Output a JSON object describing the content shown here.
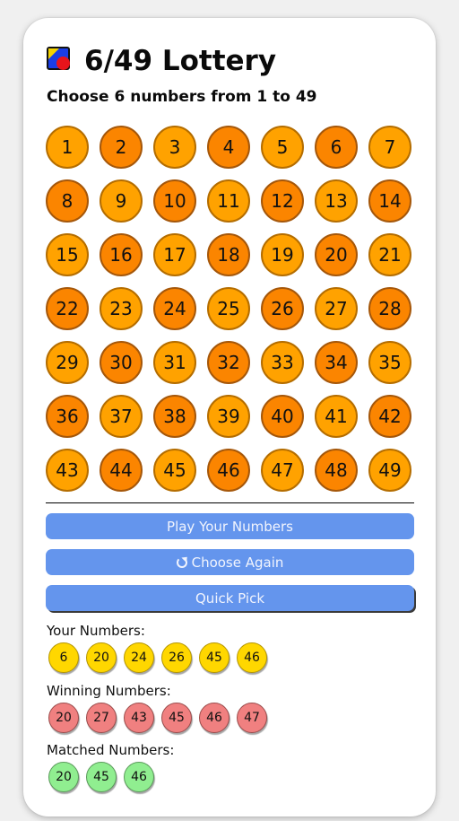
{
  "header": {
    "title": "6/49 Lottery",
    "subtitle": "Choose 6 numbers from 1 to 49"
  },
  "grid": {
    "numbers": [
      "1",
      "2",
      "3",
      "4",
      "5",
      "6",
      "7",
      "8",
      "9",
      "10",
      "11",
      "12",
      "13",
      "14",
      "15",
      "16",
      "17",
      "18",
      "19",
      "20",
      "21",
      "22",
      "23",
      "24",
      "25",
      "26",
      "27",
      "28",
      "29",
      "30",
      "31",
      "32",
      "33",
      "34",
      "35",
      "36",
      "37",
      "38",
      "39",
      "40",
      "41",
      "42",
      "43",
      "44",
      "45",
      "46",
      "47",
      "48",
      "49"
    ]
  },
  "buttons": {
    "play": "Play Your Numbers",
    "choose_again": "Choose Again",
    "quick_pick": "Quick Pick"
  },
  "results": {
    "your_label": "Your Numbers:",
    "your_numbers": [
      "6",
      "20",
      "24",
      "26",
      "45",
      "46"
    ],
    "winning_label": "Winning Numbers:",
    "winning_numbers": [
      "20",
      "27",
      "43",
      "45",
      "46",
      "47"
    ],
    "matched_label": "Matched Numbers:",
    "matched_numbers": [
      "20",
      "45",
      "46"
    ]
  },
  "colors": {
    "ball_light": "#ffa200",
    "ball_dark": "#fb8500",
    "button": "#6495ed",
    "your_ball": "#ffd700",
    "winning_ball": "#f08080",
    "matched_ball": "#90ee90"
  }
}
